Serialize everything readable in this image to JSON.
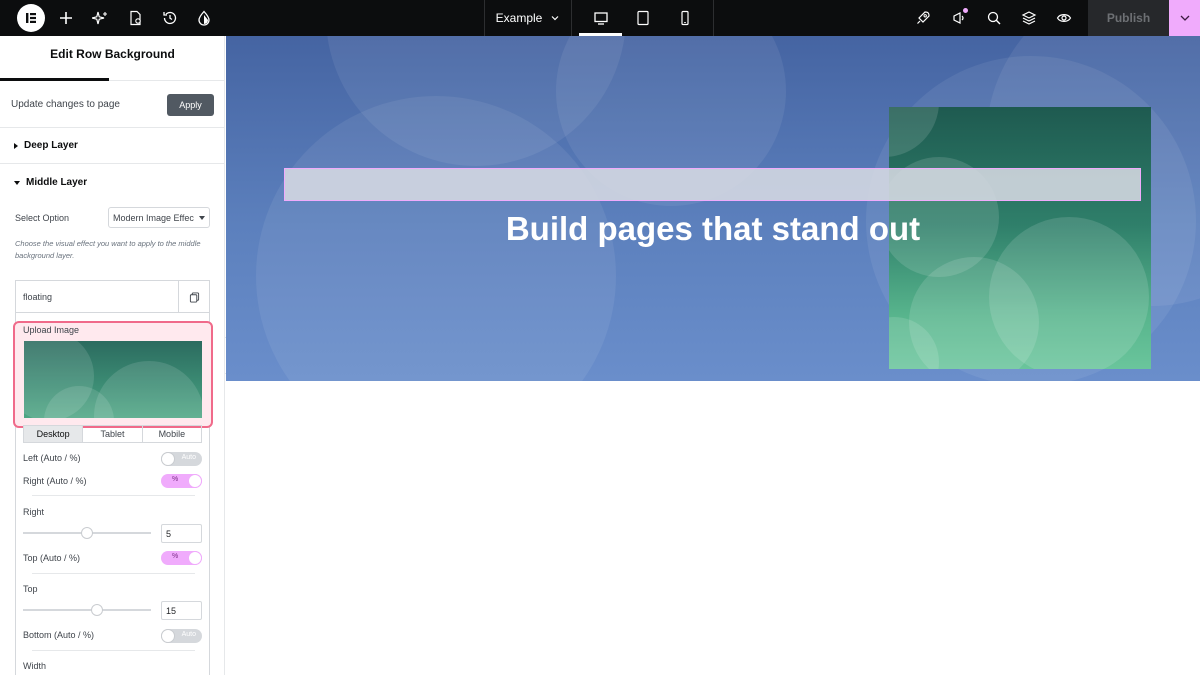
{
  "topbar": {
    "site_name": "Example",
    "publish_label": "Publish"
  },
  "panel": {
    "title": "Edit Row Background",
    "update_text": "Update changes to page",
    "apply_label": "Apply",
    "deep_layer": "Deep Layer",
    "middle_layer": "Middle Layer",
    "select_option_label": "Select Option",
    "select_option_value": "Modern Image Effec",
    "help_text": "Choose the visual effect you want to apply to the middle background layer.",
    "repeater_title": "floating",
    "upload_label": "Upload Image",
    "tabs": [
      "Desktop",
      "Tablet",
      "Mobile"
    ],
    "left_label": "Left (Auto / %)",
    "left_toggle": "Auto",
    "right_toggle_label": "Right (Auto / %)",
    "right_toggle": "%",
    "right_label": "Right",
    "right_value": "5",
    "right_slider_fraction": 0.5,
    "top_toggle_label": "Top (Auto / %)",
    "top_toggle": "%",
    "top_label": "Top",
    "top_value": "15",
    "top_slider_fraction": 0.58,
    "bottom_label": "Bottom (Auto / %)",
    "bottom_toggle": "Auto",
    "width_label": "Width"
  },
  "canvas": {
    "heading": "Build pages that stand out"
  },
  "colors": {
    "accent": "#f0abfc",
    "topbar": "#0c0d0e",
    "hero_blue": "#5c80bd",
    "highlight_border": "#f06a8a"
  }
}
